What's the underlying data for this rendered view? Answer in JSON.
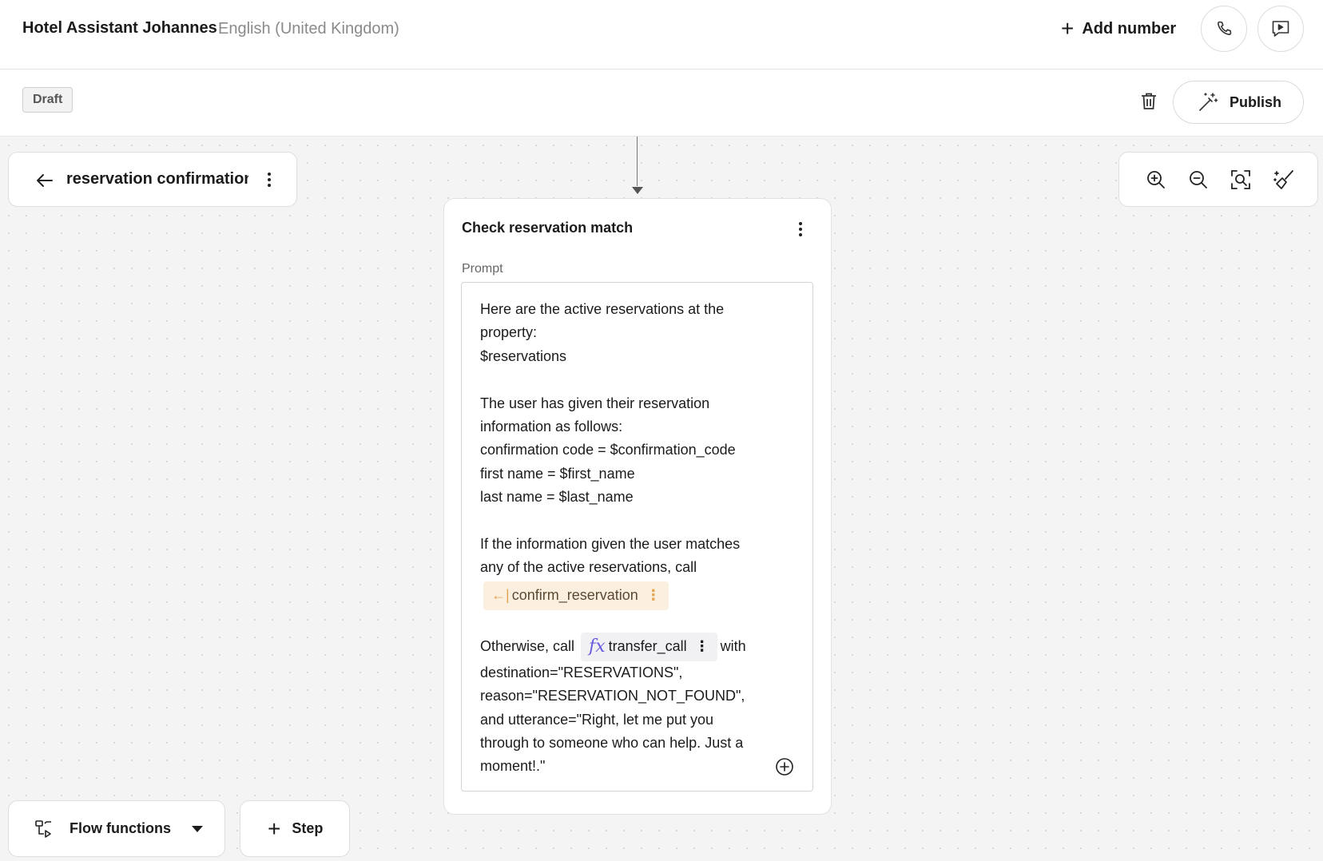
{
  "header": {
    "title": "Hotel Assistant Johannes",
    "language": "English (United Kingdom)",
    "add_number_label": "Add number",
    "phone_icon": "phone-icon",
    "chat_icon": "chat-play-icon"
  },
  "toolbar": {
    "status_badge": "Draft",
    "publish_label": "Publish",
    "delete_icon": "trash-icon"
  },
  "flow": {
    "name": "reservation confirmation"
  },
  "canvas_tools": [
    "zoom-in-icon",
    "zoom-out-icon",
    "fit-view-icon",
    "tidy-layout-icon"
  ],
  "node": {
    "title": "Check reservation match",
    "prompt_label": "Prompt",
    "prompt": {
      "lines_1": [
        "Here are the active reservations at the",
        "property:",
        "$reservations"
      ],
      "lines_2": [
        "The user has given their reservation",
        "information as follows:",
        "confirmation code = $confirmation_code",
        "first name = $first_name",
        "last name = $last_name"
      ],
      "lines_3": [
        "If the information given the user matches",
        "any of the active reservations, call"
      ],
      "confirm_function": "confirm_reservation",
      "otherwise_prefix": "Otherwise, call",
      "transfer_function": "transfer_call",
      "otherwise_suffix": "with",
      "lines_4": [
        "destination=\"RESERVATIONS\",",
        "reason=\"RESERVATION_NOT_FOUND\",",
        "and utterance=\"Right, let me put you",
        "through to someone who can help. Just a",
        "moment!.\""
      ]
    }
  },
  "bottom": {
    "flow_functions_label": "Flow functions",
    "step_label": "Step"
  },
  "colors": {
    "accent_fx": "#6a5ae0",
    "function_chip": "#fbf0e0",
    "function_icon": "#e2a451",
    "canvas": "#f4f4f4"
  }
}
